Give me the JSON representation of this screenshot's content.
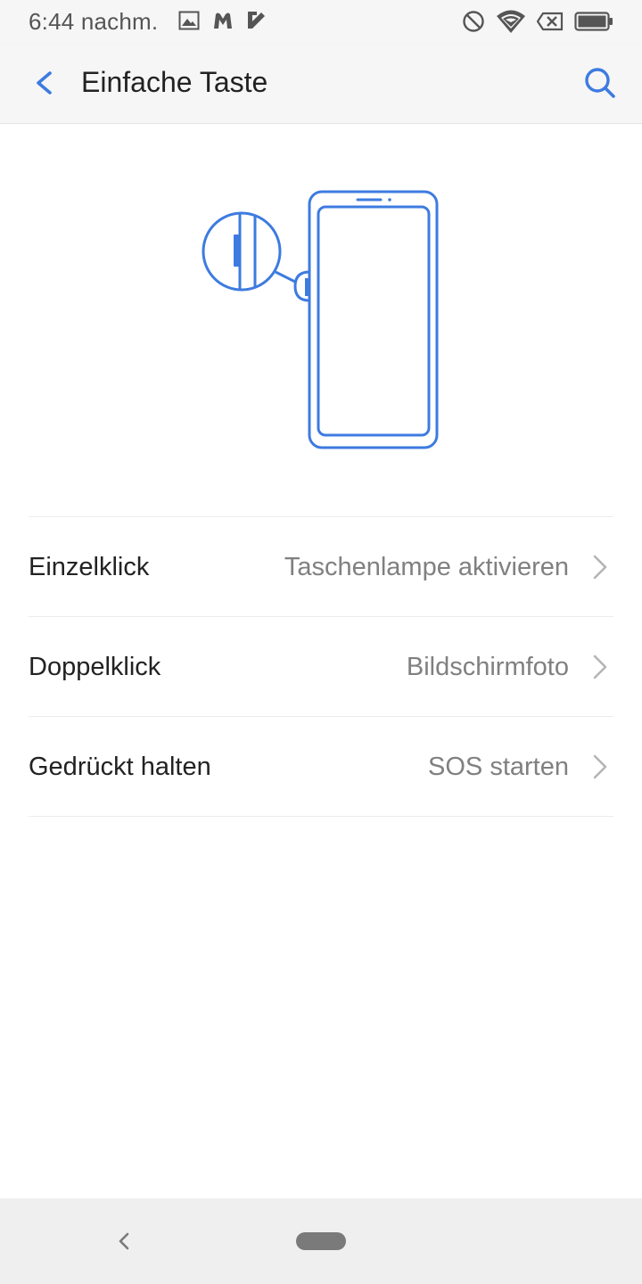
{
  "status_bar": {
    "time": "6:44 nachm.",
    "left_icons": [
      "image-icon",
      "malwarebytes-icon",
      "check-app-icon"
    ],
    "right_icons": [
      "do-not-disturb-icon",
      "wifi-icon",
      "no-sim-icon",
      "battery-icon"
    ]
  },
  "app_bar": {
    "title": "Einfache Taste",
    "back_icon": "back-arrow-icon",
    "search_icon": "search-icon"
  },
  "illustration": {
    "icon": "phone-side-button-illustration"
  },
  "settings": [
    {
      "label": "Einzelklick",
      "value": "Taschenlampe aktivieren"
    },
    {
      "label": "Doppelklick",
      "value": "Bildschirmfoto"
    },
    {
      "label": "Gedrückt halten",
      "value": "SOS starten"
    }
  ],
  "nav_bar": {
    "back_icon": "nav-back-icon",
    "home_icon": "home-pill-icon"
  },
  "colors": {
    "accent": "#3d7be0",
    "text_primary": "#222222",
    "text_secondary": "#808080",
    "background": "#ffffff",
    "bar_background": "#f6f6f6"
  }
}
